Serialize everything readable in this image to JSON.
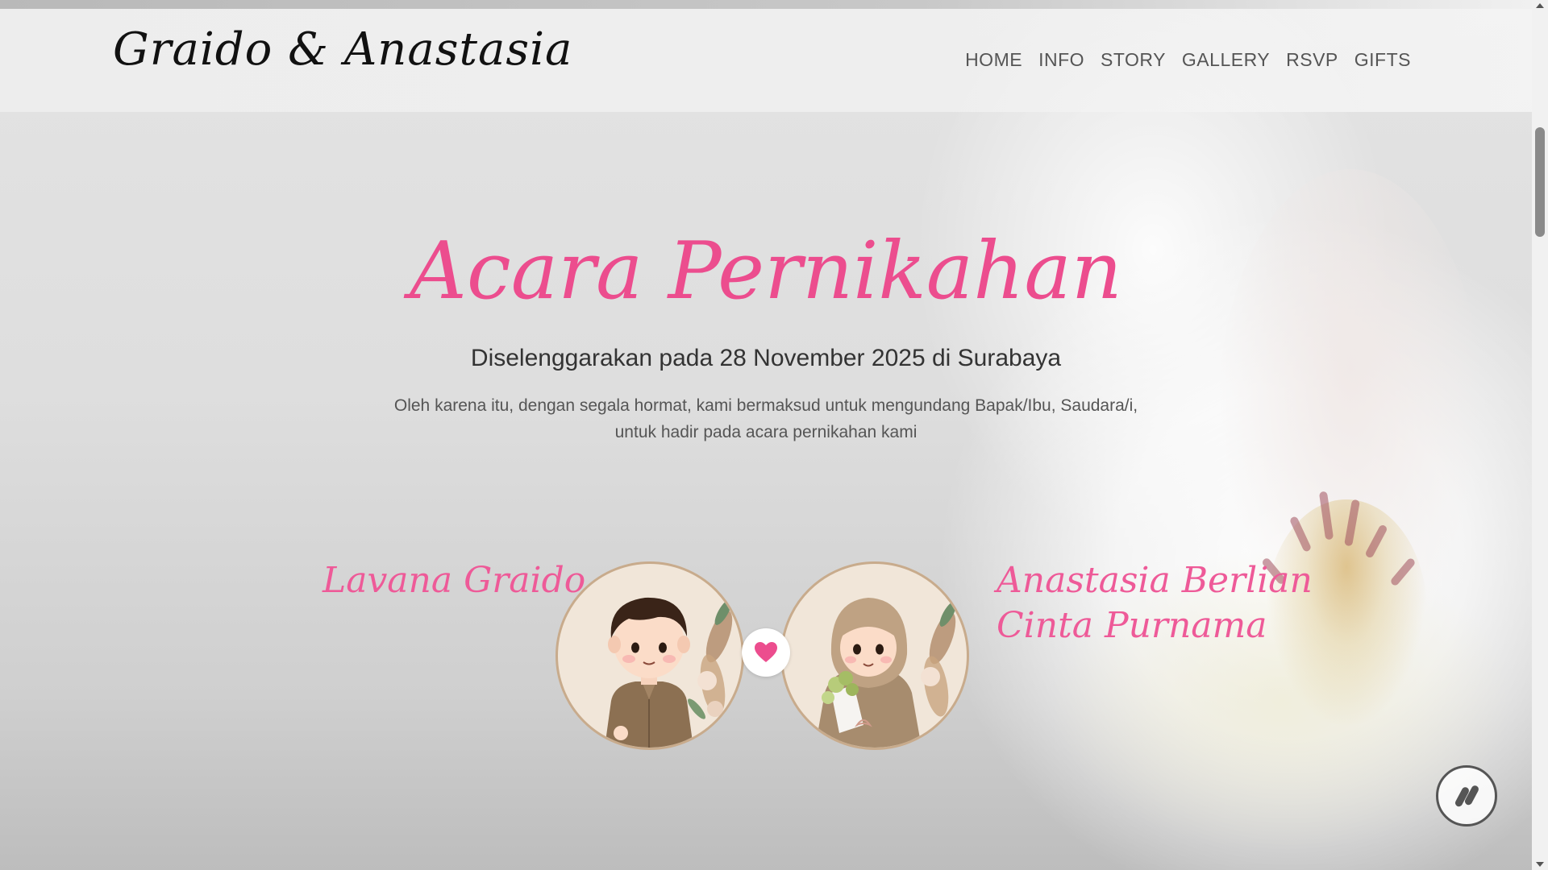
{
  "navbar": {
    "brand": "Graido & Anastasia",
    "menu": [
      "HOME",
      "INFO",
      "STORY",
      "GALLERY",
      "RSVP",
      "GIFTS"
    ]
  },
  "hero": {
    "title": "Acara Pernikahan",
    "event_line": "Diselenggarakan pada 28 November 2025 di Surabaya",
    "invite_line_1": "Oleh karena itu, dengan segala hormat, kami bermaksud untuk mengundang Bapak/Ibu, Saudara/i,",
    "invite_line_2": "untuk hadir pada acara pernikahan kami"
  },
  "couple": {
    "groom_name": "Lavana Graido",
    "bride_name": "Anastasia Berlian Cinta Purnama"
  },
  "icons": {
    "heart": "heart-icon",
    "music": "music-note-icon"
  },
  "colors": {
    "accent": "#ec4d8e",
    "name_pink": "#ee5a98"
  }
}
